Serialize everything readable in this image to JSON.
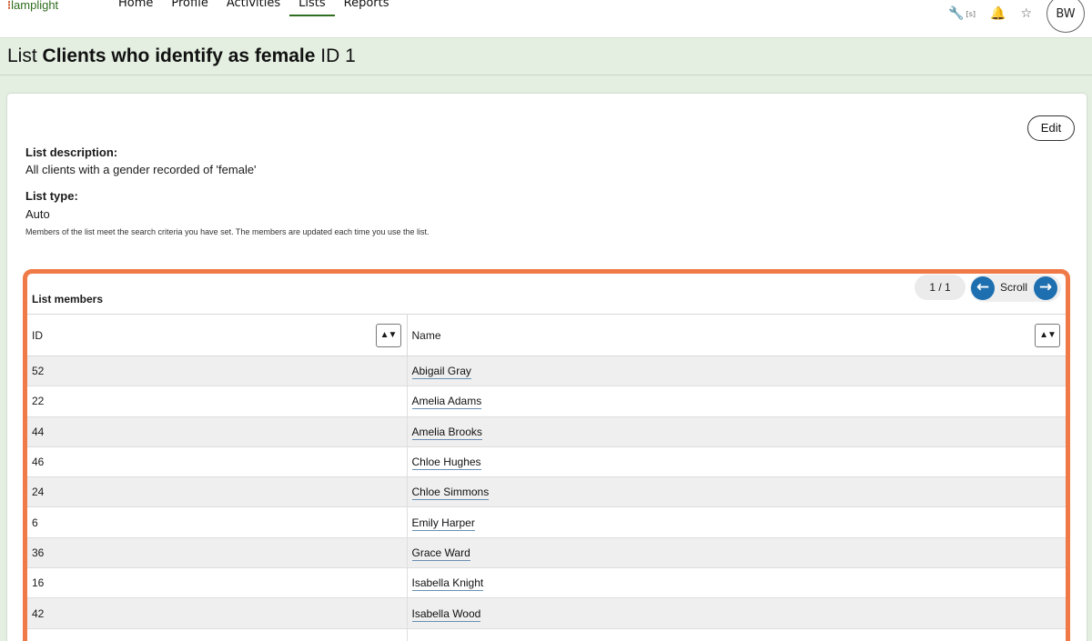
{
  "app": {
    "logo_text": "lamplight"
  },
  "nav": {
    "items": [
      {
        "label": "Home",
        "active": false
      },
      {
        "label": "Profile",
        "active": false
      },
      {
        "label": "Activities",
        "active": false
      },
      {
        "label": "Lists",
        "active": true
      },
      {
        "label": "Reports",
        "active": false
      }
    ],
    "shortcut_badge": "[s]",
    "user_initials": "BW"
  },
  "page": {
    "title_prefix": "List",
    "title_name": "Clients who identify as female",
    "title_suffix": "ID 1"
  },
  "details": {
    "edit_label": "Edit",
    "description_label": "List description:",
    "description_value": "All clients with a gender recorded of 'female'",
    "type_label": "List type:",
    "type_value": "Auto",
    "type_hint": "Members of the list meet the search criteria you have set. The members are updated each time you use the list."
  },
  "members": {
    "title": "List members",
    "page_indicator": "1 / 1",
    "scroll_label": "Scroll",
    "columns": [
      "ID",
      "Name"
    ],
    "sort_glyph": "▲▼",
    "rows": [
      {
        "id": "52",
        "name": "Abigail Gray"
      },
      {
        "id": "22",
        "name": "Amelia Adams"
      },
      {
        "id": "44",
        "name": "Amelia Brooks"
      },
      {
        "id": "46",
        "name": "Chloe Hughes"
      },
      {
        "id": "24",
        "name": "Chloe Simmons"
      },
      {
        "id": "6",
        "name": "Emily Harper"
      },
      {
        "id": "36",
        "name": "Grace Ward"
      },
      {
        "id": "16",
        "name": "Isabella Knight"
      },
      {
        "id": "42",
        "name": "Isabella Wood"
      },
      {
        "id": "",
        "name": ""
      }
    ]
  },
  "colors": {
    "accent_highlight": "#f07a47",
    "nav_active": "#2f6e1f",
    "page_background": "#e4efe1",
    "scroll_button": "#1e6fb0"
  }
}
